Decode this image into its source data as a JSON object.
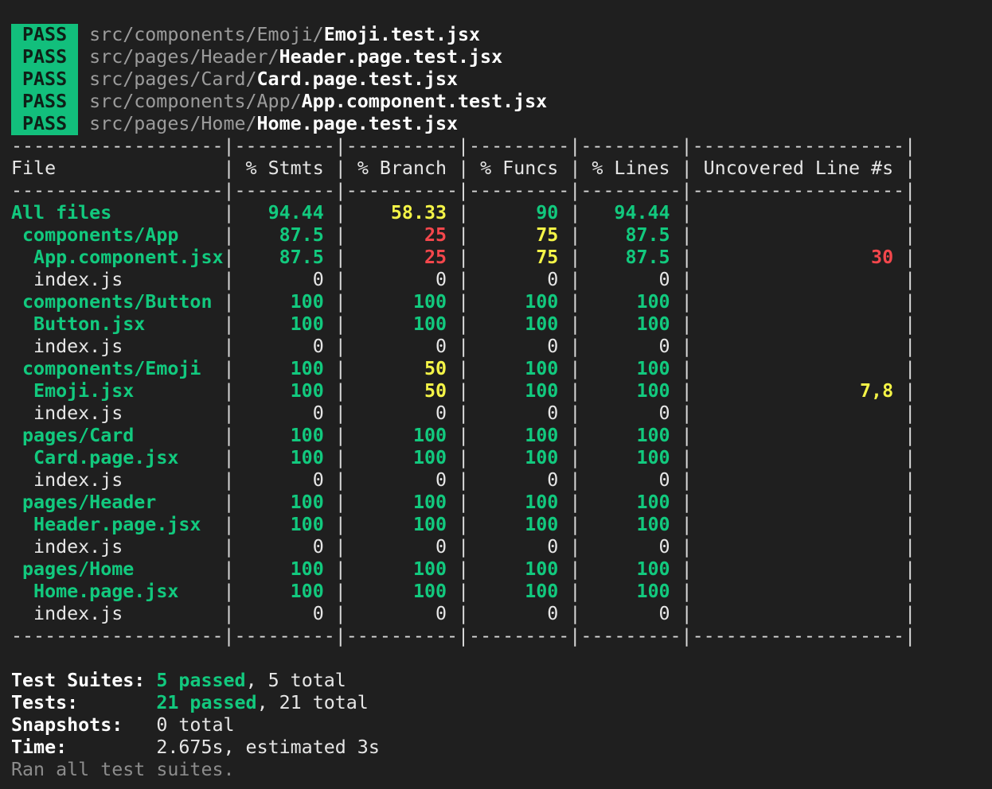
{
  "pass_lines": [
    {
      "status": "PASS",
      "dir": "src/components/Emoji/",
      "file": "Emoji.test.jsx"
    },
    {
      "status": "PASS",
      "dir": "src/pages/Header/",
      "file": "Header.page.test.jsx"
    },
    {
      "status": "PASS",
      "dir": "src/pages/Card/",
      "file": "Card.page.test.jsx"
    },
    {
      "status": "PASS",
      "dir": "src/components/App/",
      "file": "App.component.test.jsx"
    },
    {
      "status": "PASS",
      "dir": "src/pages/Home/",
      "file": "Home.page.test.jsx"
    }
  ],
  "coverage": {
    "rule_top": "-------------------|---------|----------|---------|---------|-------------------|",
    "header": [
      "File",
      "% Stmts",
      "% Branch",
      "% Funcs",
      "% Lines",
      "Uncovered Line #s"
    ],
    "rule_mid": "-------------------|---------|----------|---------|---------|-------------------|",
    "rows": [
      {
        "file": "All files",
        "indent": 0,
        "stmts": "94.44",
        "branch": "58.33",
        "funcs": "90",
        "lines": "94.44",
        "uncovered": "",
        "colors": [
          "green",
          "green",
          "yellow",
          "green",
          "green",
          ""
        ]
      },
      {
        "file": "components/App",
        "indent": 1,
        "stmts": "87.5",
        "branch": "25",
        "funcs": "75",
        "lines": "87.5",
        "uncovered": "",
        "colors": [
          "green",
          "green",
          "red",
          "yellow",
          "green",
          ""
        ]
      },
      {
        "file": "App.component.jsx",
        "indent": 2,
        "stmts": "87.5",
        "branch": "25",
        "funcs": "75",
        "lines": "87.5",
        "uncovered": "30",
        "colors": [
          "green",
          "green",
          "red",
          "yellow",
          "green",
          "red"
        ]
      },
      {
        "file": "index.js",
        "indent": 2,
        "stmts": "0",
        "branch": "0",
        "funcs": "0",
        "lines": "0",
        "uncovered": "",
        "colors": [
          "plain",
          "plain",
          "plain",
          "plain",
          "plain",
          ""
        ]
      },
      {
        "file": "components/Button",
        "indent": 1,
        "stmts": "100",
        "branch": "100",
        "funcs": "100",
        "lines": "100",
        "uncovered": "",
        "colors": [
          "green",
          "green",
          "green",
          "green",
          "green",
          ""
        ]
      },
      {
        "file": "Button.jsx",
        "indent": 2,
        "stmts": "100",
        "branch": "100",
        "funcs": "100",
        "lines": "100",
        "uncovered": "",
        "colors": [
          "green",
          "green",
          "green",
          "green",
          "green",
          ""
        ]
      },
      {
        "file": "index.js",
        "indent": 2,
        "stmts": "0",
        "branch": "0",
        "funcs": "0",
        "lines": "0",
        "uncovered": "",
        "colors": [
          "plain",
          "plain",
          "plain",
          "plain",
          "plain",
          ""
        ]
      },
      {
        "file": "components/Emoji",
        "indent": 1,
        "stmts": "100",
        "branch": "50",
        "funcs": "100",
        "lines": "100",
        "uncovered": "",
        "colors": [
          "green",
          "green",
          "yellow",
          "green",
          "green",
          ""
        ]
      },
      {
        "file": "Emoji.jsx",
        "indent": 2,
        "stmts": "100",
        "branch": "50",
        "funcs": "100",
        "lines": "100",
        "uncovered": "7,8",
        "colors": [
          "green",
          "green",
          "yellow",
          "green",
          "green",
          "yellow"
        ]
      },
      {
        "file": "index.js",
        "indent": 2,
        "stmts": "0",
        "branch": "0",
        "funcs": "0",
        "lines": "0",
        "uncovered": "",
        "colors": [
          "plain",
          "plain",
          "plain",
          "plain",
          "plain",
          ""
        ]
      },
      {
        "file": "pages/Card",
        "indent": 1,
        "stmts": "100",
        "branch": "100",
        "funcs": "100",
        "lines": "100",
        "uncovered": "",
        "colors": [
          "green",
          "green",
          "green",
          "green",
          "green",
          ""
        ]
      },
      {
        "file": "Card.page.jsx",
        "indent": 2,
        "stmts": "100",
        "branch": "100",
        "funcs": "100",
        "lines": "100",
        "uncovered": "",
        "colors": [
          "green",
          "green",
          "green",
          "green",
          "green",
          ""
        ]
      },
      {
        "file": "index.js",
        "indent": 2,
        "stmts": "0",
        "branch": "0",
        "funcs": "0",
        "lines": "0",
        "uncovered": "",
        "colors": [
          "plain",
          "plain",
          "plain",
          "plain",
          "plain",
          ""
        ]
      },
      {
        "file": "pages/Header",
        "indent": 1,
        "stmts": "100",
        "branch": "100",
        "funcs": "100",
        "lines": "100",
        "uncovered": "",
        "colors": [
          "green",
          "green",
          "green",
          "green",
          "green",
          ""
        ]
      },
      {
        "file": "Header.page.jsx",
        "indent": 2,
        "stmts": "100",
        "branch": "100",
        "funcs": "100",
        "lines": "100",
        "uncovered": "",
        "colors": [
          "green",
          "green",
          "green",
          "green",
          "green",
          ""
        ]
      },
      {
        "file": "index.js",
        "indent": 2,
        "stmts": "0",
        "branch": "0",
        "funcs": "0",
        "lines": "0",
        "uncovered": "",
        "colors": [
          "plain",
          "plain",
          "plain",
          "plain",
          "plain",
          ""
        ]
      },
      {
        "file": "pages/Home",
        "indent": 1,
        "stmts": "100",
        "branch": "100",
        "funcs": "100",
        "lines": "100",
        "uncovered": "",
        "colors": [
          "green",
          "green",
          "green",
          "green",
          "green",
          ""
        ]
      },
      {
        "file": "Home.page.jsx",
        "indent": 2,
        "stmts": "100",
        "branch": "100",
        "funcs": "100",
        "lines": "100",
        "uncovered": "",
        "colors": [
          "green",
          "green",
          "green",
          "green",
          "green",
          ""
        ]
      },
      {
        "file": "index.js",
        "indent": 2,
        "stmts": "0",
        "branch": "0",
        "funcs": "0",
        "lines": "0",
        "uncovered": "",
        "colors": [
          "plain",
          "plain",
          "plain",
          "plain",
          "plain",
          ""
        ]
      }
    ],
    "rule_bottom": "-------------------|---------|----------|---------|---------|-------------------|"
  },
  "summary": {
    "suites_label": "Test Suites:",
    "suites_passed": "5 passed",
    "suites_total": ", 5 total",
    "tests_label": "Tests:",
    "tests_passed": "21 passed",
    "tests_total": ", 21 total",
    "snapshots_label": "Snapshots:",
    "snapshots_value": "0 total",
    "time_label": "Time:",
    "time_value": "2.675s, estimated 3s",
    "footer": "Ran all test suites."
  },
  "colors": {
    "background": "#1f1f1f",
    "pass_badge": "#12bf7c",
    "green": "#12c97e",
    "yellow": "#f4f447",
    "red": "#f4474c"
  }
}
